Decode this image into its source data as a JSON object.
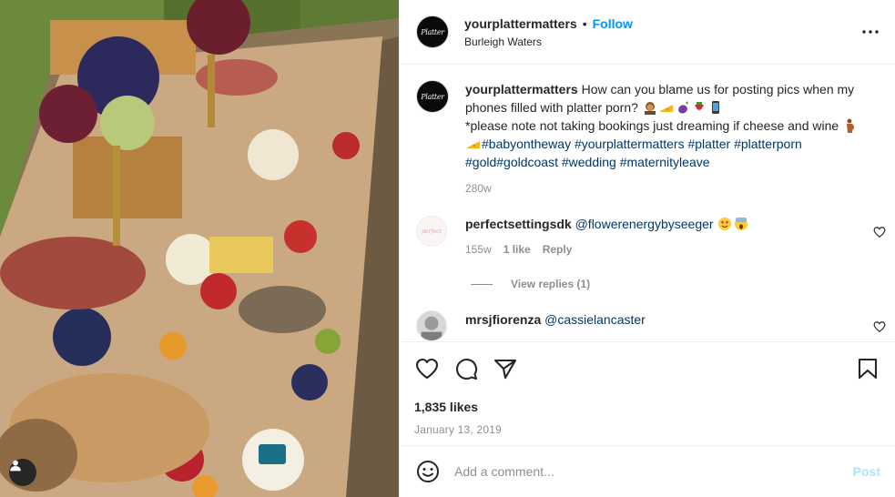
{
  "post": {
    "author": {
      "username": "yourplattermatters",
      "location": "Burleigh Waters",
      "avatar_text": "Platter"
    },
    "follow_label": "Follow",
    "separator": "•",
    "caption": {
      "username": "yourplattermatters",
      "text_1": "How can you blame us for posting pics when my phones filled with platter porn?",
      "text_2": "*please note not taking bookings just dreaming if cheese and wine",
      "hashtags": [
        "#babyontheway",
        "#yourplattermatters",
        "#platter",
        "#platterporn",
        "#gold",
        "#goldcoast",
        "#wedding",
        "#maternityleave"
      ],
      "age": "280w"
    },
    "comments": [
      {
        "username": "perfectsettingsdk",
        "mention": "@flowerenergybyseeger",
        "age": "155w",
        "likes": "1 like",
        "reply_label": "Reply",
        "view_replies": "View replies (1)",
        "avatar_text": "perfect"
      },
      {
        "username": "mrsjfiorenza",
        "mention": "@cassielancaster"
      }
    ],
    "likes": "1,835 likes",
    "date": "January 13, 2019",
    "add_comment_placeholder": "Add a comment...",
    "post_label": "Post"
  },
  "colors": {
    "link": "#0095f6",
    "hashtag": "#00376b",
    "muted": "#8e8e8e",
    "post_disabled": "#b2dffc"
  },
  "icons": [
    "more-icon",
    "heart-icon",
    "comment-icon",
    "share-icon",
    "bookmark-icon",
    "emoji-icon",
    "user-tag-icon"
  ]
}
